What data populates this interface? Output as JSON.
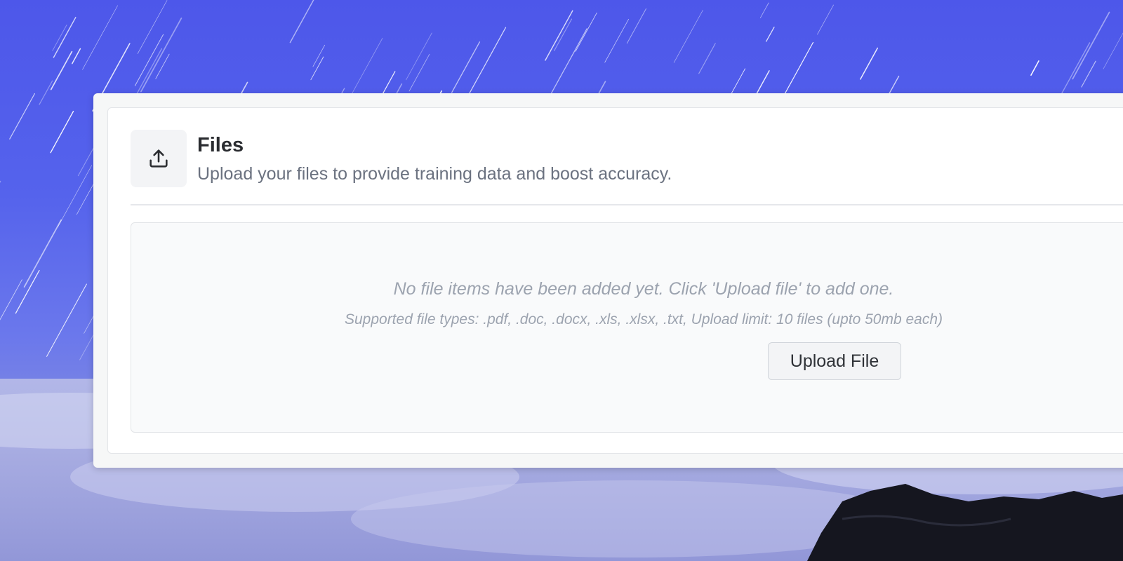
{
  "files_panel": {
    "title": "Files",
    "subtitle": "Upload your files to provide training data and boost accuracy.",
    "icon": "upload-icon"
  },
  "dropzone": {
    "empty_message": "No file items have been added yet. Click 'Upload file' to add one.",
    "supported_types": "Supported file types: .pdf, .doc, .docx, .xls, .xlsx, .txt, Upload limit: 10 files (upto 50mb each)",
    "upload_button_label": "Upload File"
  },
  "colors": {
    "wallpaper_sky": "#4d57ea",
    "panel_background": "#ffffff",
    "dropzone_background": "#f9fafb",
    "muted_text": "#9ca3af",
    "subtitle_text": "#6b7280"
  }
}
